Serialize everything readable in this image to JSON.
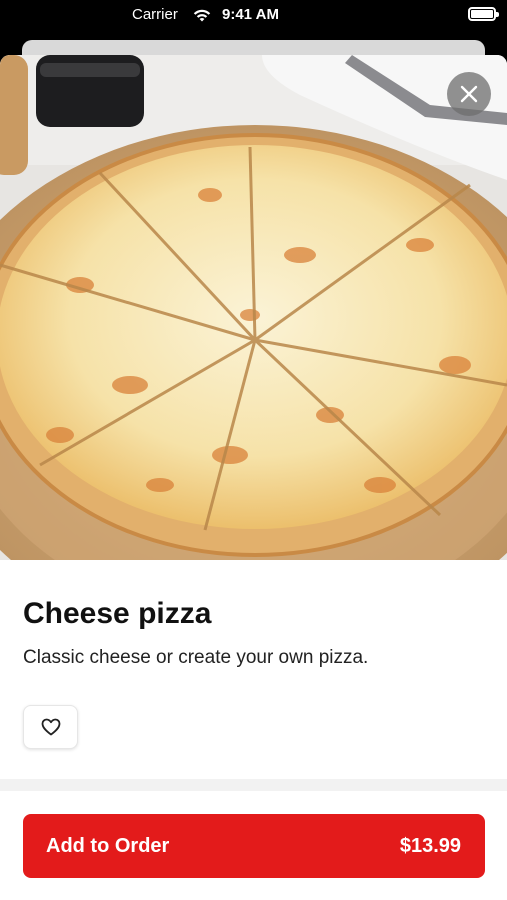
{
  "status_bar": {
    "carrier": "Carrier",
    "time": "9:41 AM"
  },
  "item": {
    "name": "Cheese pizza",
    "description": "Classic cheese or create your own pizza."
  },
  "actions": {
    "add_to_order_label": "Add to Order",
    "price": "$13.99"
  },
  "icons": {
    "close": "close-icon",
    "favorite": "heart-icon",
    "wifi": "wifi-icon",
    "battery": "battery-icon"
  },
  "colors": {
    "accent": "#e31b1b",
    "status_bar_bg": "#000000",
    "card_bg": "#ffffff"
  }
}
